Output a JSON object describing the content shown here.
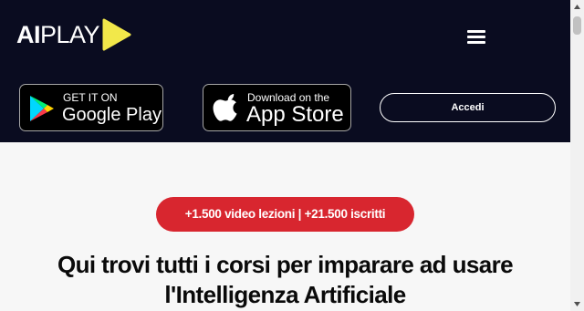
{
  "logo": {
    "text_bold": "AI",
    "text_light": "PLAY",
    "play_color": "#f2e84a"
  },
  "header": {
    "background": "#0a0c20",
    "menu_icon": "hamburger-menu-icon"
  },
  "stores": {
    "google_play": {
      "small": "GET IT ON",
      "big": "Google Play"
    },
    "app_store": {
      "small": "Download on the",
      "big": "App Store"
    }
  },
  "login_button": {
    "label": "Accedi"
  },
  "stats_pill": {
    "label": "+1.500 video lezioni | +21.500 iscritti",
    "color": "#d8262f"
  },
  "headline": {
    "text": "Qui trovi tutti i corsi per imparare ad usare l'Intelligenza Artificiale"
  }
}
